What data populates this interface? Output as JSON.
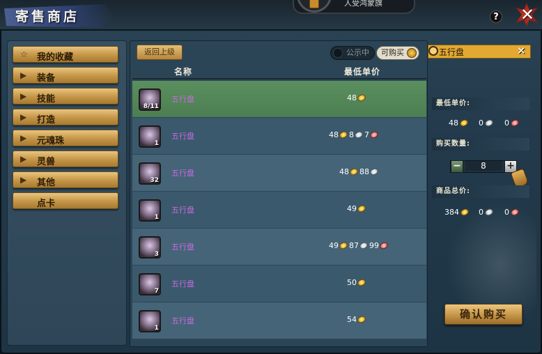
{
  "window": {
    "title": "寄售商店",
    "top_banner": "人受鸿蒙旗",
    "help_label": "?",
    "close_label": "✕"
  },
  "sidebar": {
    "items": [
      {
        "label": "我的收藏",
        "icon": "star-icon"
      },
      {
        "label": "装备",
        "icon": "play-triangle-icon"
      },
      {
        "label": "技能",
        "icon": "play-triangle-icon"
      },
      {
        "label": "打造",
        "icon": "play-triangle-icon"
      },
      {
        "label": "元魂珠",
        "icon": "play-triangle-icon"
      },
      {
        "label": "灵兽",
        "icon": "play-triangle-icon"
      },
      {
        "label": "其他",
        "icon": "play-triangle-icon"
      },
      {
        "label": "点卡",
        "icon": ""
      }
    ]
  },
  "list": {
    "back_label": "返回上级",
    "filter_public": "公示中",
    "filter_buyable": "可购买",
    "col_name": "名称",
    "col_price": "最低单价",
    "rows": [
      {
        "name": "五行盘",
        "qty": "8/11",
        "gold": "48",
        "silver": "",
        "copper": "",
        "selected": true
      },
      {
        "name": "五行盘",
        "qty": "1",
        "gold": "48",
        "silver": "8",
        "copper": "7",
        "selected": false
      },
      {
        "name": "五行盘",
        "qty": "32",
        "gold": "48",
        "silver": "88",
        "copper": "",
        "selected": false
      },
      {
        "name": "五行盘",
        "qty": "1",
        "gold": "49",
        "silver": "",
        "copper": "",
        "selected": false
      },
      {
        "name": "五行盘",
        "qty": "3",
        "gold": "49",
        "silver": "87",
        "copper": "99",
        "selected": false
      },
      {
        "name": "五行盘",
        "qty": "7",
        "gold": "50",
        "silver": "",
        "copper": "",
        "selected": false
      },
      {
        "name": "五行盘",
        "qty": "1",
        "gold": "54",
        "silver": "",
        "copper": "",
        "selected": false
      }
    ]
  },
  "detail": {
    "search_value": "五行盘",
    "search_clear": "✕",
    "min_price_label": "最低单价:",
    "min_price": {
      "gold": "48",
      "silver": "0",
      "copper": "0"
    },
    "qty_label": "购买数量:",
    "qty_value": "8",
    "minus_label": "−",
    "plus_label": "+",
    "total_label": "商品总价:",
    "total_price": {
      "gold": "384",
      "silver": "0",
      "copper": "0"
    },
    "confirm_label": "确认购买"
  },
  "colors": {
    "accent_gold": "#c49547",
    "selected_row": "#4c7e52",
    "item_name": "#c86be0"
  }
}
